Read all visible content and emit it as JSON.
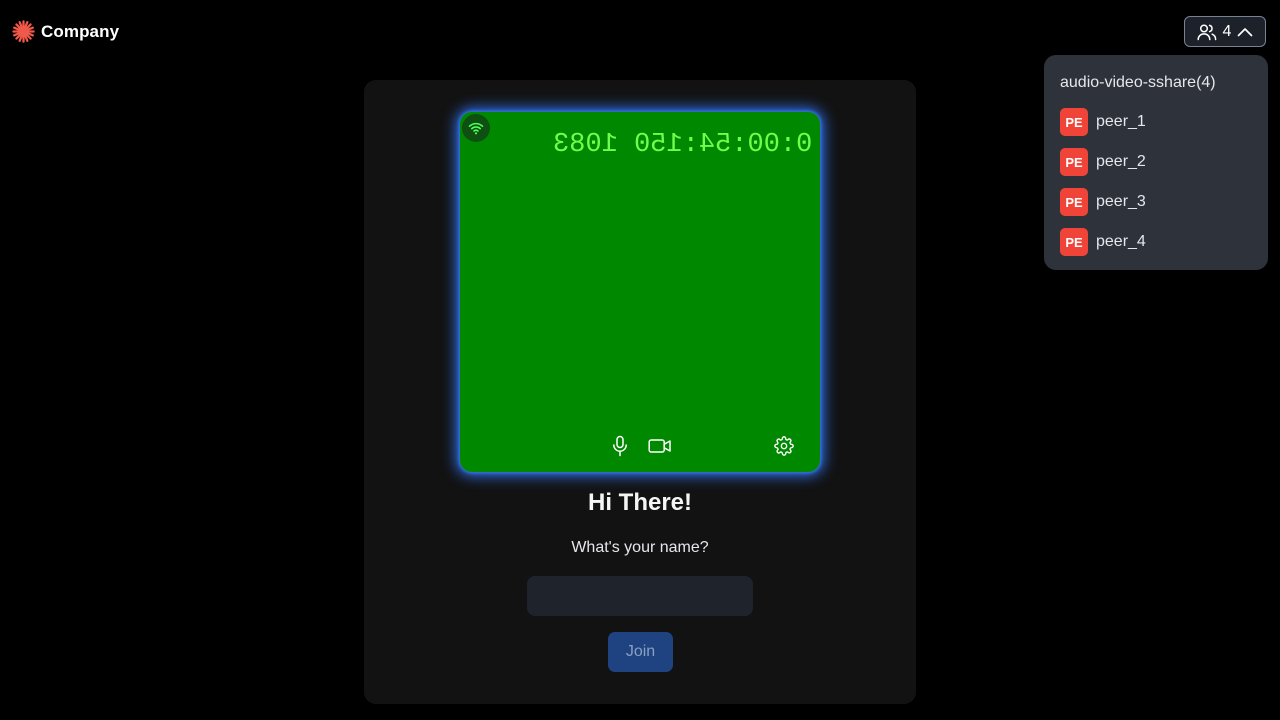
{
  "app": {
    "logo_icon": "asterisk-logo-icon",
    "logo_text": "Company",
    "brand_color": "#f0584a"
  },
  "participants_button": {
    "icon": "people-icon",
    "count": "4",
    "chevron": "chevron-up-icon"
  },
  "participants_dropdown": {
    "title": "audio-video-sshare(4)",
    "avatar_color": "#f04438",
    "peers": [
      {
        "initials": "PE",
        "name": "peer_1"
      },
      {
        "initials": "PE",
        "name": "peer_2"
      },
      {
        "initials": "PE",
        "name": "peer_3"
      },
      {
        "initials": "PE",
        "name": "peer_4"
      }
    ]
  },
  "preview": {
    "background_color": "#008800",
    "timer_text": "0:00:54:150 1083",
    "timer_mirrored": true,
    "network_icon": "wifi-icon",
    "controls": {
      "mic_icon": "microphone-icon",
      "camera_icon": "video-camera-icon",
      "settings_icon": "gear-icon"
    }
  },
  "join_form": {
    "greeting": "Hi There!",
    "name_prompt": "What's your name?",
    "name_value": "",
    "join_label": "Join",
    "join_bg_color": "#1f4280",
    "join_text_color": "#8aa0c2"
  }
}
